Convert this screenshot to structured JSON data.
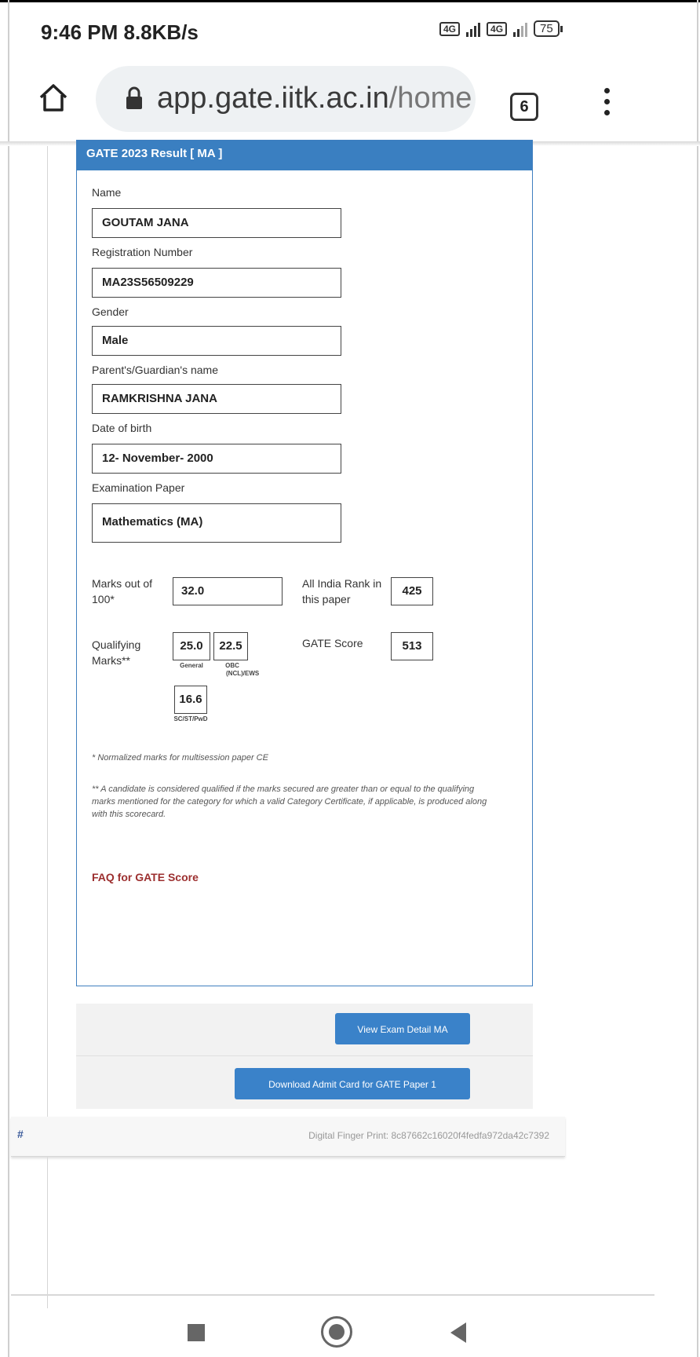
{
  "status_bar": {
    "time": "9:46 PM",
    "speed": "8.8KB/s",
    "sim1": "4G",
    "sim2": "4G",
    "battery": "75"
  },
  "browser": {
    "url_host": "app.gate.iitk.ac.in",
    "url_path": "/home",
    "tab_count": "6",
    "icons": [
      "home-icon",
      "lock-icon",
      "kebab-menu-icon"
    ]
  },
  "result": {
    "header": "GATE 2023 Result [ MA ]",
    "fields": [
      {
        "label": "Name",
        "value": "GOUTAM JANA"
      },
      {
        "label": "Registration Number",
        "value": "MA23S56509229"
      },
      {
        "label": "Gender",
        "value": "Male"
      },
      {
        "label": "Parent's/Guardian's name",
        "value": "RAMKRISHNA JANA"
      },
      {
        "label": "Date of birth",
        "value": "12- November- 2000"
      },
      {
        "label": "Examination Paper",
        "value": "Mathematics (MA)"
      }
    ],
    "marks": {
      "label_line1": "Marks out of",
      "label_line2": "100*",
      "value": "32.0"
    },
    "rank": {
      "label_line1": "All India Rank in",
      "label_line2": "this paper",
      "value": "425"
    },
    "qualifying": {
      "label_line1": "Qualifying",
      "label_line2": "Marks**",
      "general": {
        "value": "25.0",
        "caption": "General"
      },
      "obc": {
        "value": "22.5",
        "caption_line1": "OBC",
        "caption_line2": "(NCL)/EWS"
      },
      "sc": {
        "value": "16.6",
        "caption": "SC/ST/PwD"
      }
    },
    "gate_score": {
      "label": "GATE Score",
      "value": "513"
    },
    "footnote1": "* Normalized marks for multisession paper CE",
    "footnote2": "** A candidate is considered qualified if the marks secured are greater than or equal to the qualifying marks mentioned for the category for which a valid Category Certificate, if applicable, is produced along with this scorecard.",
    "faq": "FAQ for GATE Score"
  },
  "actions": {
    "view_exam": "View Exam Detail MA",
    "download_admit": "Download Admit Card for GATE Paper 1"
  },
  "footer": {
    "left": "#",
    "fingerprint": "Digital Finger Print: 8c87662c16020f4fedfa972da42c7392"
  },
  "accent_colors": {
    "header": "#3a7fc1",
    "button": "#3a82c9",
    "link": "#9c2f2f"
  }
}
